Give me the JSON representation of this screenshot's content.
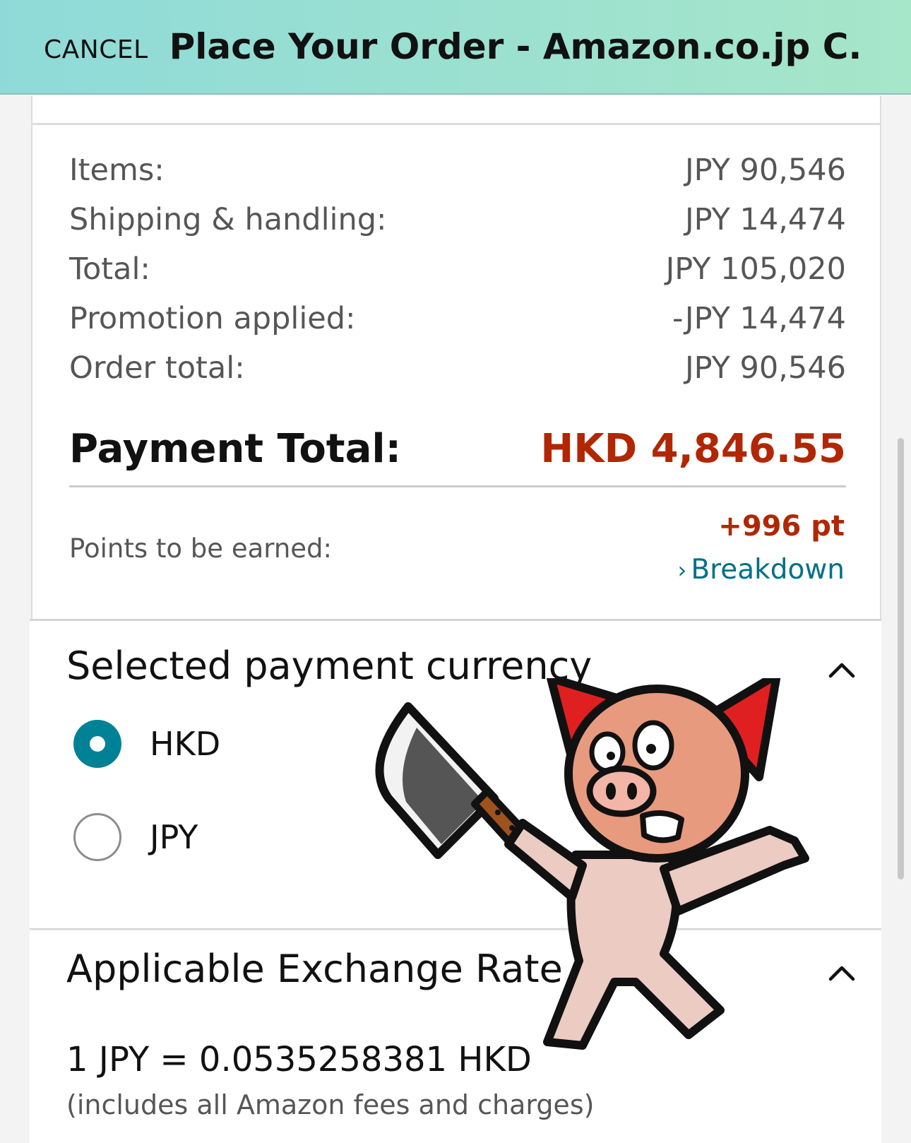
{
  "header": {
    "cancel_label": "CANCEL",
    "title": "Place Your Order - Amazon.co.jp C..."
  },
  "summary": {
    "rows": [
      {
        "label": "Items:",
        "value": "JPY 90,546"
      },
      {
        "label": "Shipping & handling:",
        "value": "JPY 14,474"
      },
      {
        "label": "Total:",
        "value": "JPY 105,020"
      },
      {
        "label": "Promotion applied:",
        "value": "-JPY 14,474"
      },
      {
        "label": "Order total:",
        "value": "JPY 90,546"
      }
    ],
    "payment_total_label": "Payment Total:",
    "payment_total_value": "HKD 4,846.55",
    "points_label": "Points to be earned:",
    "points_value": "+996 pt",
    "breakdown_chevron": "›",
    "breakdown_label": "Breakdown"
  },
  "currency": {
    "title": "Selected payment currency",
    "options": [
      {
        "label": "HKD",
        "selected": true
      },
      {
        "label": "JPY",
        "selected": false
      }
    ]
  },
  "exchange": {
    "title": "Applicable Exchange Rate",
    "rate": "1 JPY = 0.0535258381 HKD",
    "note": "(includes all Amazon fees and charges)"
  },
  "colors": {
    "accent_teal": "#008296",
    "price_red": "#b12704",
    "link": "#007185"
  },
  "icons": {
    "collapse": "chevron-up-icon",
    "sticker": "pig-with-cleaver-sticker"
  }
}
